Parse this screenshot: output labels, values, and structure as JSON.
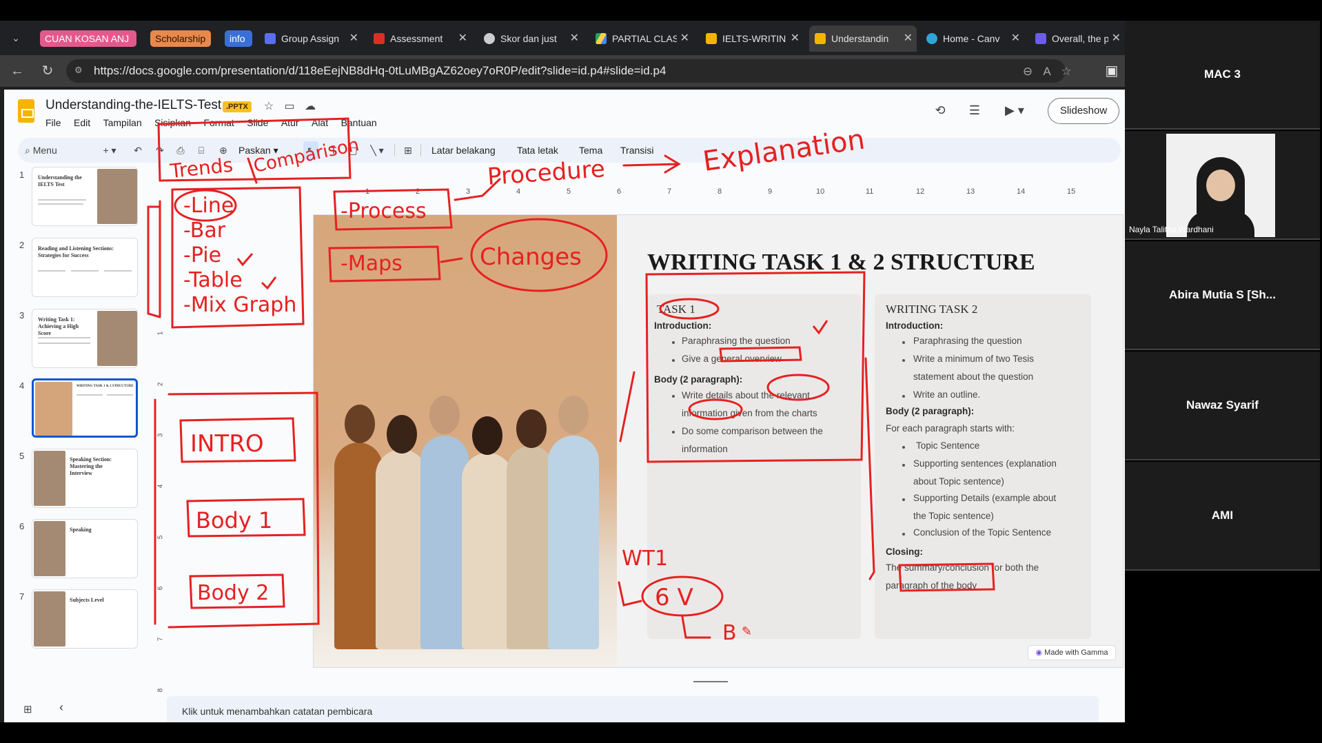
{
  "browser": {
    "tab_groups": [
      {
        "label": "CUAN KOSAN ANJ",
        "color": "#e25a8b"
      },
      {
        "label": "Scholarship",
        "color": "#e8894c"
      },
      {
        "label": "info",
        "color": "#3b6fd8"
      }
    ],
    "tabs": [
      {
        "title": "Group Assign",
        "icon": "assignment-icon"
      },
      {
        "title": "Assessment",
        "icon": "pdf-icon"
      },
      {
        "title": "Skor dan just",
        "icon": "chatgpt-icon"
      },
      {
        "title": "PARTIAL CLAS",
        "icon": "drive-icon"
      },
      {
        "title": "IELTS-WRITIN",
        "icon": "slides-icon"
      },
      {
        "title": "Understandin",
        "icon": "slides-icon",
        "active": true
      },
      {
        "title": "Home - Canv",
        "icon": "canva-icon"
      },
      {
        "title": "Overall, the p",
        "icon": "ai-icon"
      }
    ],
    "url": "https://docs.google.com/presentation/d/118eEejNB8dHq-0tLuMBgAZ62oey7oR0P/edit?slide=id.p4#slide=id.p4"
  },
  "app": {
    "doc_title": "Understanding-the-IELTS-Test",
    "badge": ".PPTX",
    "menus": [
      "File",
      "Edit",
      "Tampilan",
      "Sisipkan",
      "Format",
      "Slide",
      "Atur",
      "Alat",
      "Bantuan"
    ],
    "slideshow_label": "Slideshow",
    "toolbar": {
      "menu_label": "Menu",
      "zoom_label": "Paskan",
      "background": "Latar belakang",
      "layout": "Tata letak",
      "theme": "Tema",
      "transition": "Transisi"
    },
    "ruler_numbers": [
      "1",
      "2",
      "3",
      "4",
      "5",
      "6",
      "7",
      "8",
      "9",
      "10",
      "11",
      "12",
      "13",
      "14",
      "15"
    ],
    "vruler_numbers": [
      "1",
      "2",
      "3",
      "4",
      "5",
      "6",
      "7",
      "8"
    ],
    "speaker_notes_placeholder": "Klik untuk menambahkan catatan pembicara"
  },
  "thumbnails": [
    {
      "num": "1",
      "title": "Understanding the IELTS Test"
    },
    {
      "num": "2",
      "title": "Reading and Listening Sections: Strategies for Success"
    },
    {
      "num": "3",
      "title": "Writing Task 1: Achieving a High Score"
    },
    {
      "num": "4",
      "title": "WRITING TASK 1 & 2 STRUCTURE",
      "selected": true
    },
    {
      "num": "5",
      "title": "Speaking Section: Mastering the Interview"
    },
    {
      "num": "6",
      "title": "Speaking"
    },
    {
      "num": "7",
      "title": "Subjects Level"
    }
  ],
  "slide": {
    "title": "WRITING TASK 1 & 2 STRUCTURE",
    "task1": {
      "heading": "TASK 1",
      "intro_label": "Introduction:",
      "intro_items": [
        "Paraphrasing the question",
        "Give a general overview"
      ],
      "body_label": "Body (2 paragraph):",
      "body_items": [
        "Write details about the relevant information given from the charts",
        "Do some comparison between the information"
      ]
    },
    "task2": {
      "heading": "WRITING TASK 2",
      "intro_label": "Introduction:",
      "intro_items": [
        "Paraphrasing the question",
        "Write a minimum of two Tesis statement about the question",
        "Write an outline."
      ],
      "body_label": "Body (2 paragraph):",
      "body_sub": "For each paragraph starts with:",
      "body_items": [
        "Topic Sentence",
        "Supporting sentences (explanation about Topic sentence)",
        "Supporting Details (example about the Topic sentence)",
        "Conclusion of the Topic Sentence"
      ],
      "closing_label": "Closing:",
      "closing_text": "The summary/conclusion for both the paragraph of the body"
    },
    "badge": "Made with Gamma"
  },
  "participants": [
    {
      "name": "MAC 3",
      "video": false
    },
    {
      "name": "Nayla Talitha Wardhani",
      "video": true
    },
    {
      "name": "Abira Mutia S [Sh...",
      "video": false
    },
    {
      "name": "Nawaz Syarif",
      "video": false
    },
    {
      "name": "AMI",
      "video": false
    }
  ],
  "annotations": {
    "trends": "Trends",
    "comparison": "Comparison",
    "explanation": "Explanation",
    "procedure": "Procedure",
    "list": [
      "-Line",
      "-Bar",
      "-Pie",
      "-Table",
      "-Mix Graph"
    ],
    "process": "-Process",
    "maps": "-Maps",
    "changes": "Changes",
    "intro": "INTRO",
    "body1": "Body 1",
    "body2": "Body 2",
    "wt1": "WT1",
    "six_v": "6 V",
    "b": "B",
    "ink_color": "#e62020"
  },
  "colors": {
    "accent": "#0b57d0",
    "slides_yellow": "#f4b400"
  }
}
